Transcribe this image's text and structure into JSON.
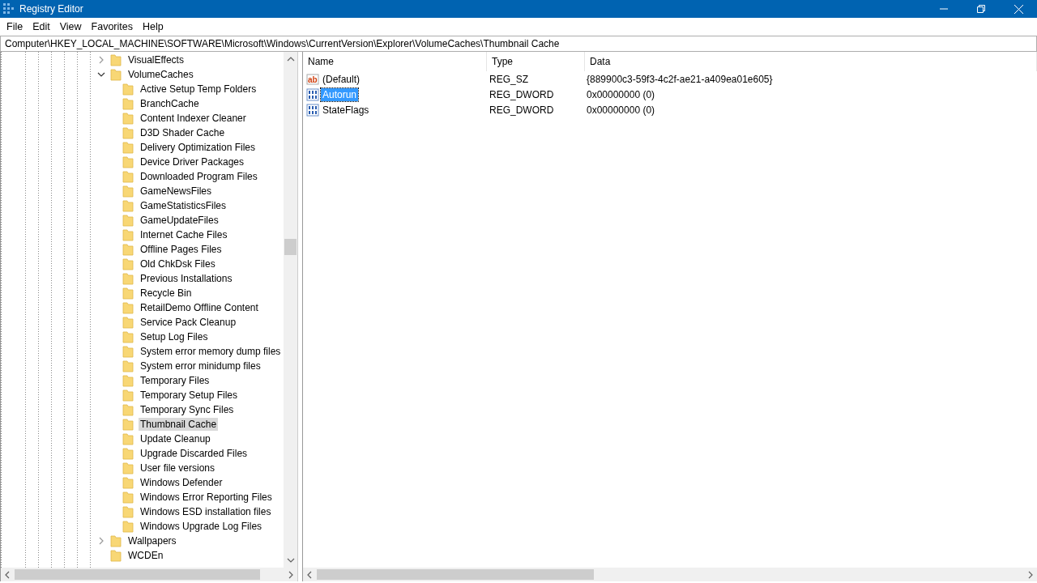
{
  "window": {
    "title": "Registry Editor"
  },
  "menu": [
    "File",
    "Edit",
    "View",
    "Favorites",
    "Help"
  ],
  "address": "Computer\\HKEY_LOCAL_MACHINE\\SOFTWARE\\Microsoft\\Windows\\CurrentVersion\\Explorer\\VolumeCaches\\Thumbnail Cache",
  "tree": [
    {
      "label": "VisualEffects",
      "expanded": false,
      "selected": false
    },
    {
      "label": "VolumeCaches",
      "expanded": true,
      "selected": false,
      "children": [
        {
          "label": "Active Setup Temp Folders",
          "selected": false
        },
        {
          "label": "BranchCache",
          "selected": false
        },
        {
          "label": "Content Indexer Cleaner",
          "selected": false
        },
        {
          "label": "D3D Shader Cache",
          "selected": false
        },
        {
          "label": "Delivery Optimization Files",
          "selected": false
        },
        {
          "label": "Device Driver Packages",
          "selected": false
        },
        {
          "label": "Downloaded Program Files",
          "selected": false
        },
        {
          "label": "GameNewsFiles",
          "selected": false
        },
        {
          "label": "GameStatisticsFiles",
          "selected": false
        },
        {
          "label": "GameUpdateFiles",
          "selected": false
        },
        {
          "label": "Internet Cache Files",
          "selected": false
        },
        {
          "label": "Offline Pages Files",
          "selected": false
        },
        {
          "label": "Old ChkDsk Files",
          "selected": false
        },
        {
          "label": "Previous Installations",
          "selected": false
        },
        {
          "label": "Recycle Bin",
          "selected": false
        },
        {
          "label": "RetailDemo Offline Content",
          "selected": false
        },
        {
          "label": "Service Pack Cleanup",
          "selected": false
        },
        {
          "label": "Setup Log Files",
          "selected": false
        },
        {
          "label": "System error memory dump files",
          "selected": false
        },
        {
          "label": "System error minidump files",
          "selected": false
        },
        {
          "label": "Temporary Files",
          "selected": false
        },
        {
          "label": "Temporary Setup Files",
          "selected": false
        },
        {
          "label": "Temporary Sync Files",
          "selected": false
        },
        {
          "label": "Thumbnail Cache",
          "selected": true
        },
        {
          "label": "Update Cleanup",
          "selected": false
        },
        {
          "label": "Upgrade Discarded Files",
          "selected": false
        },
        {
          "label": "User file versions",
          "selected": false
        },
        {
          "label": "Windows Defender",
          "selected": false
        },
        {
          "label": "Windows Error Reporting Files",
          "selected": false
        },
        {
          "label": "Windows ESD installation files",
          "selected": false
        },
        {
          "label": "Windows Upgrade Log Files",
          "selected": false
        }
      ]
    },
    {
      "label": "Wallpapers",
      "expanded": false,
      "selected": false
    },
    {
      "label": "WCDEn",
      "selected": false
    }
  ],
  "table": {
    "columns": [
      "Name",
      "Type",
      "Data"
    ],
    "rows": [
      {
        "kind": "string",
        "icon_text": "ab",
        "name": "(Default)",
        "type": "REG_SZ",
        "data": "{889900c3-59f3-4c2f-ae21-a409ea01e605}",
        "selected": false
      },
      {
        "kind": "binary",
        "name": "Autorun",
        "type": "REG_DWORD",
        "data": "0x00000000 (0)",
        "selected": true
      },
      {
        "kind": "binary",
        "name": "StateFlags",
        "type": "REG_DWORD",
        "data": "0x00000000 (0)",
        "selected": false
      }
    ]
  }
}
